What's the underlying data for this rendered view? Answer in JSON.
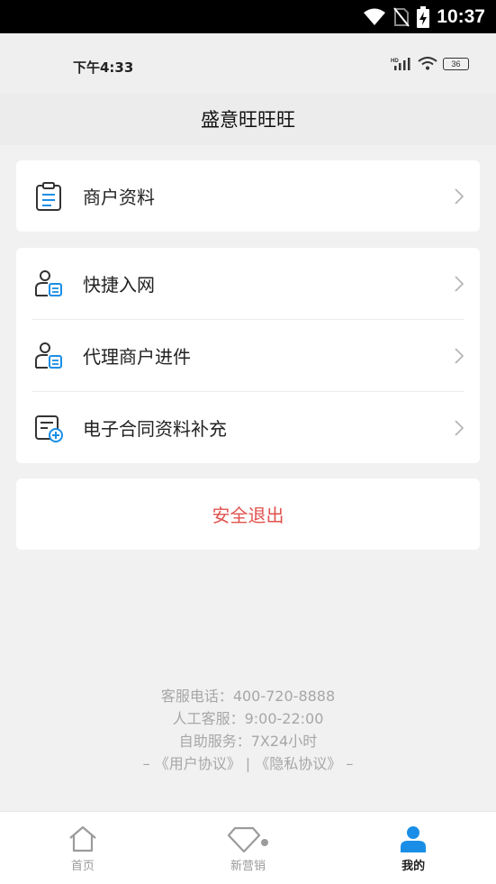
{
  "system_bar": {
    "time": "10:37"
  },
  "app_status": {
    "time": "下午4:33",
    "battery": "36"
  },
  "navbar": {
    "title": "盛意旺旺旺"
  },
  "menu_groups": [
    [
      {
        "label": "商户资料",
        "icon": "clipboard-icon"
      }
    ],
    [
      {
        "label": "快捷入网",
        "icon": "user-document-icon"
      },
      {
        "label": "代理商户进件",
        "icon": "user-document-icon"
      },
      {
        "label": "电子合同资料补充",
        "icon": "document-add-icon"
      }
    ]
  ],
  "logout": {
    "label": "安全退出"
  },
  "footer": {
    "phone": "客服电话：400-720-8888",
    "manual": "人工客服：9:00-22:00",
    "self": "自助服务：7X24小时",
    "links": "– 《用户协议》 | 《隐私协议》 –"
  },
  "tabs": [
    {
      "label": "首页",
      "icon": "home-icon"
    },
    {
      "label": "新营销",
      "icon": "diamond-icon"
    },
    {
      "label": "我的",
      "icon": "user-icon"
    }
  ],
  "colors": {
    "accent": "#1a8ee6",
    "danger": "#e0524e"
  }
}
